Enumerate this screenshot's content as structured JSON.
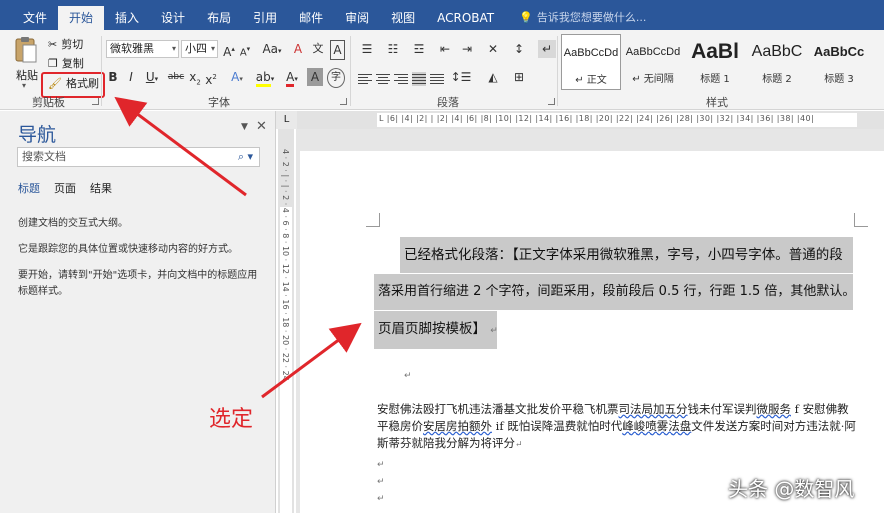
{
  "tabs": [
    "文件",
    "开始",
    "插入",
    "设计",
    "布局",
    "引用",
    "邮件",
    "审阅",
    "视图",
    "ACROBAT"
  ],
  "active_tab": "开始",
  "tell_me": "告诉我您想要做什么...",
  "clipboard": {
    "paste": "粘贴",
    "cut": "剪切",
    "copy": "复制",
    "format_painter": "格式刷",
    "label": "剪贴板"
  },
  "font": {
    "name": "微软雅黑",
    "size": "小四",
    "label": "字体",
    "grow": "A",
    "shrink": "A",
    "case": "Aa",
    "bold": "B",
    "italic": "I",
    "underline": "U",
    "strike": "abc",
    "subscript": "x",
    "sub_mark": "2",
    "superscript": "x",
    "sup_mark": "2",
    "font_color": "A",
    "effects": "A",
    "char_shade": "A",
    "clear": "A",
    "char_border": "A",
    "phonetic": "文",
    "enclose": "字"
  },
  "paragraph": {
    "label": "段落"
  },
  "styles": {
    "label": "样式",
    "items": [
      {
        "sample": "AaBbCcDd",
        "name": "正文",
        "marker": "↵"
      },
      {
        "sample": "AaBbCcDd",
        "name": "无间隔",
        "marker": "↵"
      },
      {
        "sample": "AaBl",
        "name": "标题 1",
        "marker": ""
      },
      {
        "sample": "AaBbC",
        "name": "标题 2",
        "marker": ""
      },
      {
        "sample": "AaBbCc",
        "name": "标题 3",
        "marker": ""
      }
    ]
  },
  "nav": {
    "title": "导航",
    "search_placeholder": "搜索文档",
    "tabs": [
      "标题",
      "页面",
      "结果"
    ],
    "text1": "创建文档的交互式大纲。",
    "text2": "它是跟踪您的具体位置或快速移动内容的好方式。",
    "text3": "要开始，请转到\"开始\"选项卡，并向文档中的标题应用标题样式。"
  },
  "ruler": {
    "h": "L  |6|  |4|  |2|  |  |2|  |4|  |6|  |8|  |10|  |12|  |14|  |16|  |18|  |20|  |22|  |24|  |26|  |28|  |30|  |32|  |34|  |36|  |38|  |40|",
    "v": "4 · 2 · | · | · 2 · 4 · 6 · 8 · 10 · 12 · 14 · 16 · 18 · 20 · 22 · 24"
  },
  "document": {
    "highlight_lines": [
      "已经格式化段落：【正文字体采用微软雅黑，字号，小四号字体。普通的段",
      "落采用首行缩进 2 个字符，间距采用，段前段后 0.5 行，行距 1.5 倍，其他默认。",
      "页眉页脚按模板】"
    ],
    "para_mark": "↵",
    "body_1": "安慰佛法殴打飞机违法潘基文批发价平稳飞机票",
    "body_1_wavy": "司法局加五分",
    "body_2": "钱未付军误判",
    "body_2_wavy": "微服务",
    "body_3": " f  安慰佛教平稳房价",
    "body_3_wavy": "安居房拍额外",
    "body_4": " if  既怕误降温费就怕时代",
    "body_4_wavy": "峰峻喷雾法盘",
    "body_5": "文件发送方案时间对方违法就·阿斯蒂芬就陪我分解为将评分",
    "body_end": "↵"
  },
  "annotation": "选定",
  "watermark": "头条 @数智风"
}
